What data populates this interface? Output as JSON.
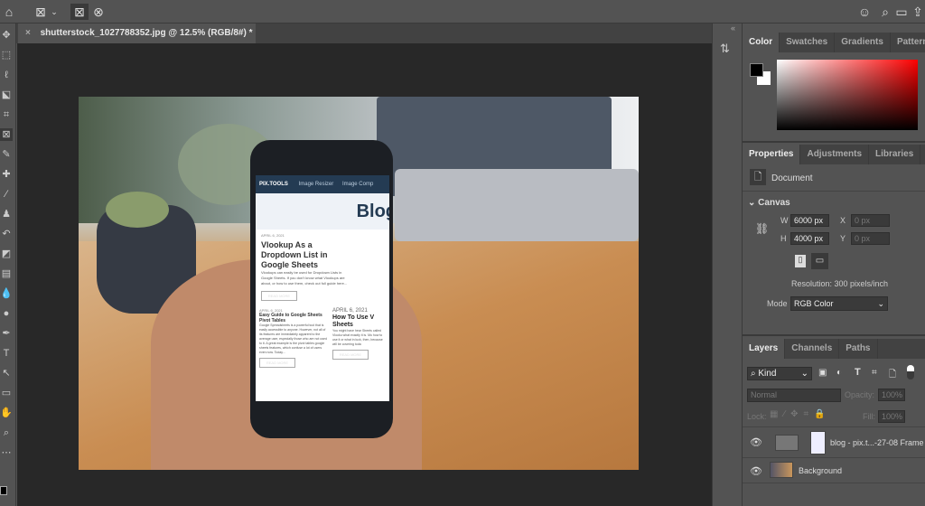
{
  "topbar": {
    "icons": [
      "home-icon",
      "frame-tool-icon",
      "chevron-down-icon",
      "rectangle-frame-icon",
      "ellipse-frame-icon",
      "user-icon",
      "search-icon",
      "workspace-icon",
      "share-icon"
    ]
  },
  "document": {
    "tab_title": "shutterstock_1027788352.jpg @ 12.5% (RGB/8#) *",
    "close": "×"
  },
  "image": {
    "brand": "PIX.TOOLS",
    "nav": [
      "Image Resizer",
      "Image Comp"
    ],
    "hero": "Blog",
    "post1": {
      "date": "APRIL 6, 2021",
      "title": "Vlookup As a Dropdown List in Google Sheets",
      "excerpt": "Vlookups can easily be used for Dropdown Lists in Google Sheets. If you don't know what Vlookups are about, or how to use them, check out full guide here...",
      "button": "READ MORE"
    },
    "post2": {
      "date": "APRIL 6, 2021",
      "title": "Easy Guide to Google Sheets Pivot Tables",
      "excerpt": "Google Spreadsheets is a powerful tool that is easily accessible to anyone. However, not all of its features are immediately apparent to the average user, especially those who are not used to it. A great example is the pivot tables google sheets features, which confuse a lot of users even now. Today...",
      "button": "READ MORE"
    },
    "post3": {
      "date": "APRIL 6, 2021",
      "title": "How To Use V Sheets",
      "excerpt": "You might have hear Sheets called Vlooku what exactly it is. Mo how to use it or what in luck, then, because will be covering toda",
      "button": "READ MORE"
    }
  },
  "color_panel": {
    "tabs": [
      "Color",
      "Swatches",
      "Gradients",
      "Patterns"
    ],
    "active": "Color",
    "foreground": "#000000",
    "background": "#ffffff",
    "hue": "#ff0000"
  },
  "properties": {
    "tabs": [
      "Properties",
      "Adjustments",
      "Libraries"
    ],
    "active": "Properties",
    "type": "Document",
    "section": "Canvas",
    "w_label": "W",
    "w": "6000 px",
    "h_label": "H",
    "h": "4000 px",
    "x_label": "X",
    "x": "0 px",
    "y_label": "Y",
    "y": "0 px",
    "resolution": "Resolution: 300 pixels/inch",
    "mode_label": "Mode",
    "mode": "RGB Color"
  },
  "layers": {
    "tabs": [
      "Layers",
      "Channels",
      "Paths"
    ],
    "active": "Layers",
    "filter": "Kind",
    "blend": "Normal",
    "opacity_label": "Opacity:",
    "opacity": "100%",
    "lock_label": "Lock:",
    "fill_label": "Fill:",
    "fill": "100%",
    "items": [
      {
        "name": "blog - pix.t...-27-08 Frame",
        "visible": true
      },
      {
        "name": "Background",
        "visible": true
      }
    ]
  }
}
